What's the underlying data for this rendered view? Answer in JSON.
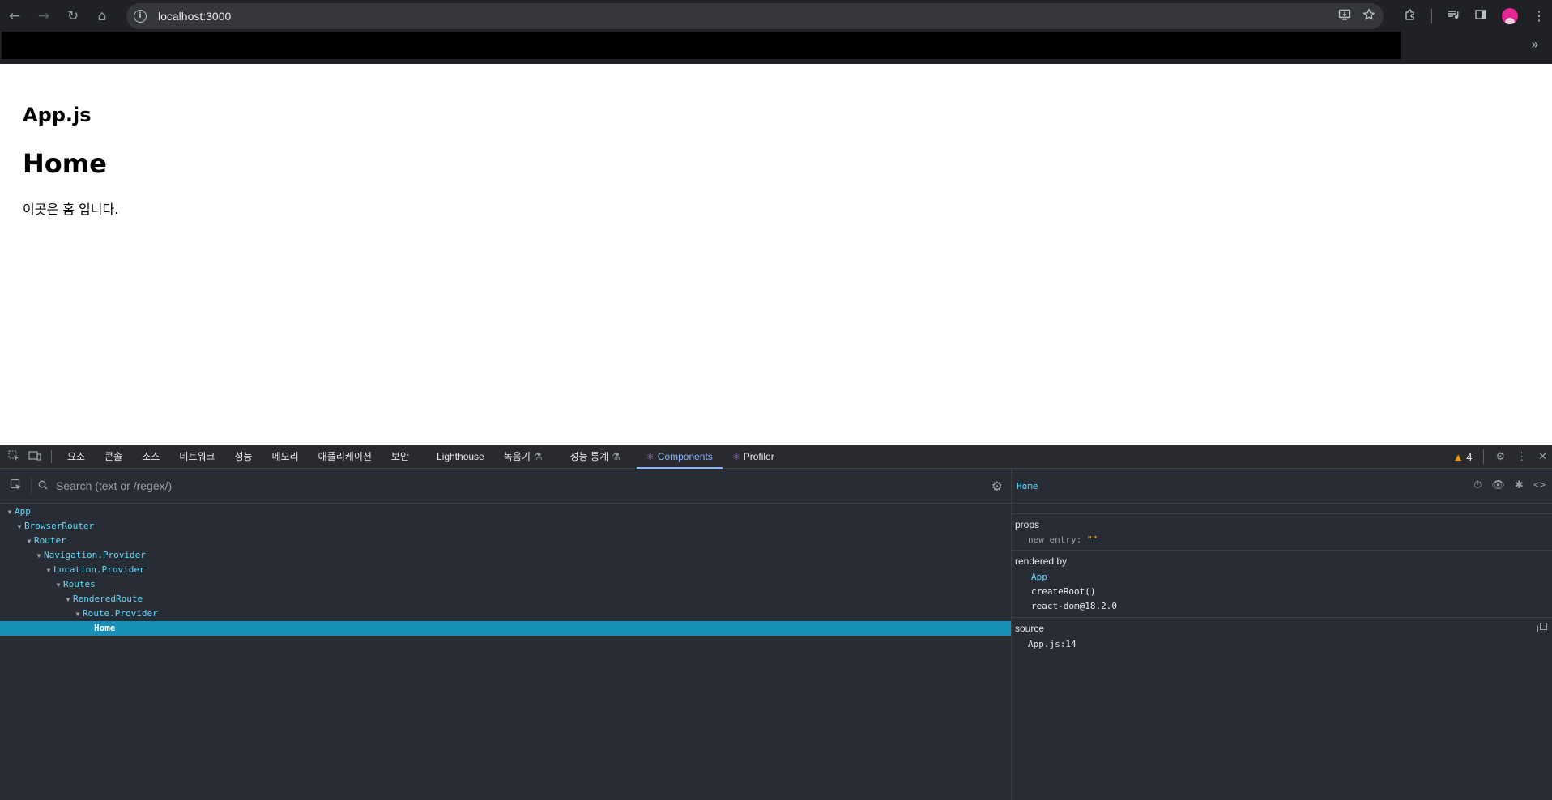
{
  "browser": {
    "url": "localhost:3000",
    "nav": {
      "back": "←",
      "forward": "→",
      "reload": "↻",
      "home": "⌂"
    },
    "more_bookmarks": "»"
  },
  "page": {
    "file_heading": "App.js",
    "title": "Home",
    "body_text": "이곳은 홈 입니다."
  },
  "devtools": {
    "tabs": [
      {
        "label": "요소"
      },
      {
        "label": "콘솔"
      },
      {
        "label": "소스"
      },
      {
        "label": "네트워크"
      },
      {
        "label": "성능"
      },
      {
        "label": "메모리"
      },
      {
        "label": "애플리케이션"
      },
      {
        "label": "보안"
      },
      {
        "label": "Lighthouse"
      },
      {
        "label": "녹음기"
      },
      {
        "label": "성능 통계"
      },
      {
        "label": "Components"
      },
      {
        "label": "Profiler"
      }
    ],
    "warning_count": "4",
    "search_placeholder": "Search (text or /regex/)",
    "tree": [
      {
        "name": "App"
      },
      {
        "name": "BrowserRouter"
      },
      {
        "name": "Router"
      },
      {
        "name": "Navigation.Provider"
      },
      {
        "name": "Location.Provider"
      },
      {
        "name": "Routes"
      },
      {
        "name": "RenderedRoute"
      },
      {
        "name": "Route.Provider"
      },
      {
        "name": "Home"
      }
    ],
    "inspector": {
      "selected": "Home",
      "props_label": "props",
      "props_new_entry": "new entry",
      "props_value": "\"\"",
      "rendered_by_label": "rendered by",
      "rendered_by": [
        "App",
        "createRoot()",
        "react-dom@18.2.0"
      ],
      "source_label": "source",
      "source_value": "App.js:14"
    }
  },
  "colors": {
    "accent": "#8ab4f8",
    "component_name": "#61dafb",
    "selection": "#178fb9",
    "devtools_bg": "#282c34"
  }
}
